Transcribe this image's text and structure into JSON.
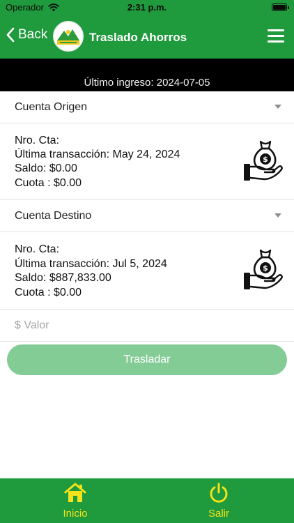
{
  "status_bar": {
    "carrier": "Operador",
    "time": "2:31 p.m."
  },
  "nav": {
    "back_label": "Back",
    "title": "Traslado Ahorros"
  },
  "last_login": "Último ingreso: 2024-07-05",
  "origin": {
    "select_label": "Cuenta Origen",
    "account_number": "Nro. Cta:",
    "last_transaction": "Última transacción: May 24, 2024",
    "balance": "Saldo: $0.00",
    "fee": "Cuota : $0.00"
  },
  "destination": {
    "select_label": "Cuenta Destino",
    "account_number": "Nro. Cta:",
    "last_transaction": "Última transacción: Jul 5, 2024",
    "balance": "Saldo: $887,833.00",
    "fee": "Cuota : $0.00"
  },
  "amount_field": {
    "placeholder": "$ Valor"
  },
  "transfer_button": "Trasladar",
  "tabs": [
    {
      "label": "Inicio",
      "icon": "home-icon"
    },
    {
      "label": "Salir",
      "icon": "power-icon"
    }
  ],
  "colors": {
    "brand_green": "#1f9a3c",
    "button_disabled_green": "#84cc96",
    "tab_yellow": "#f4e21a"
  }
}
